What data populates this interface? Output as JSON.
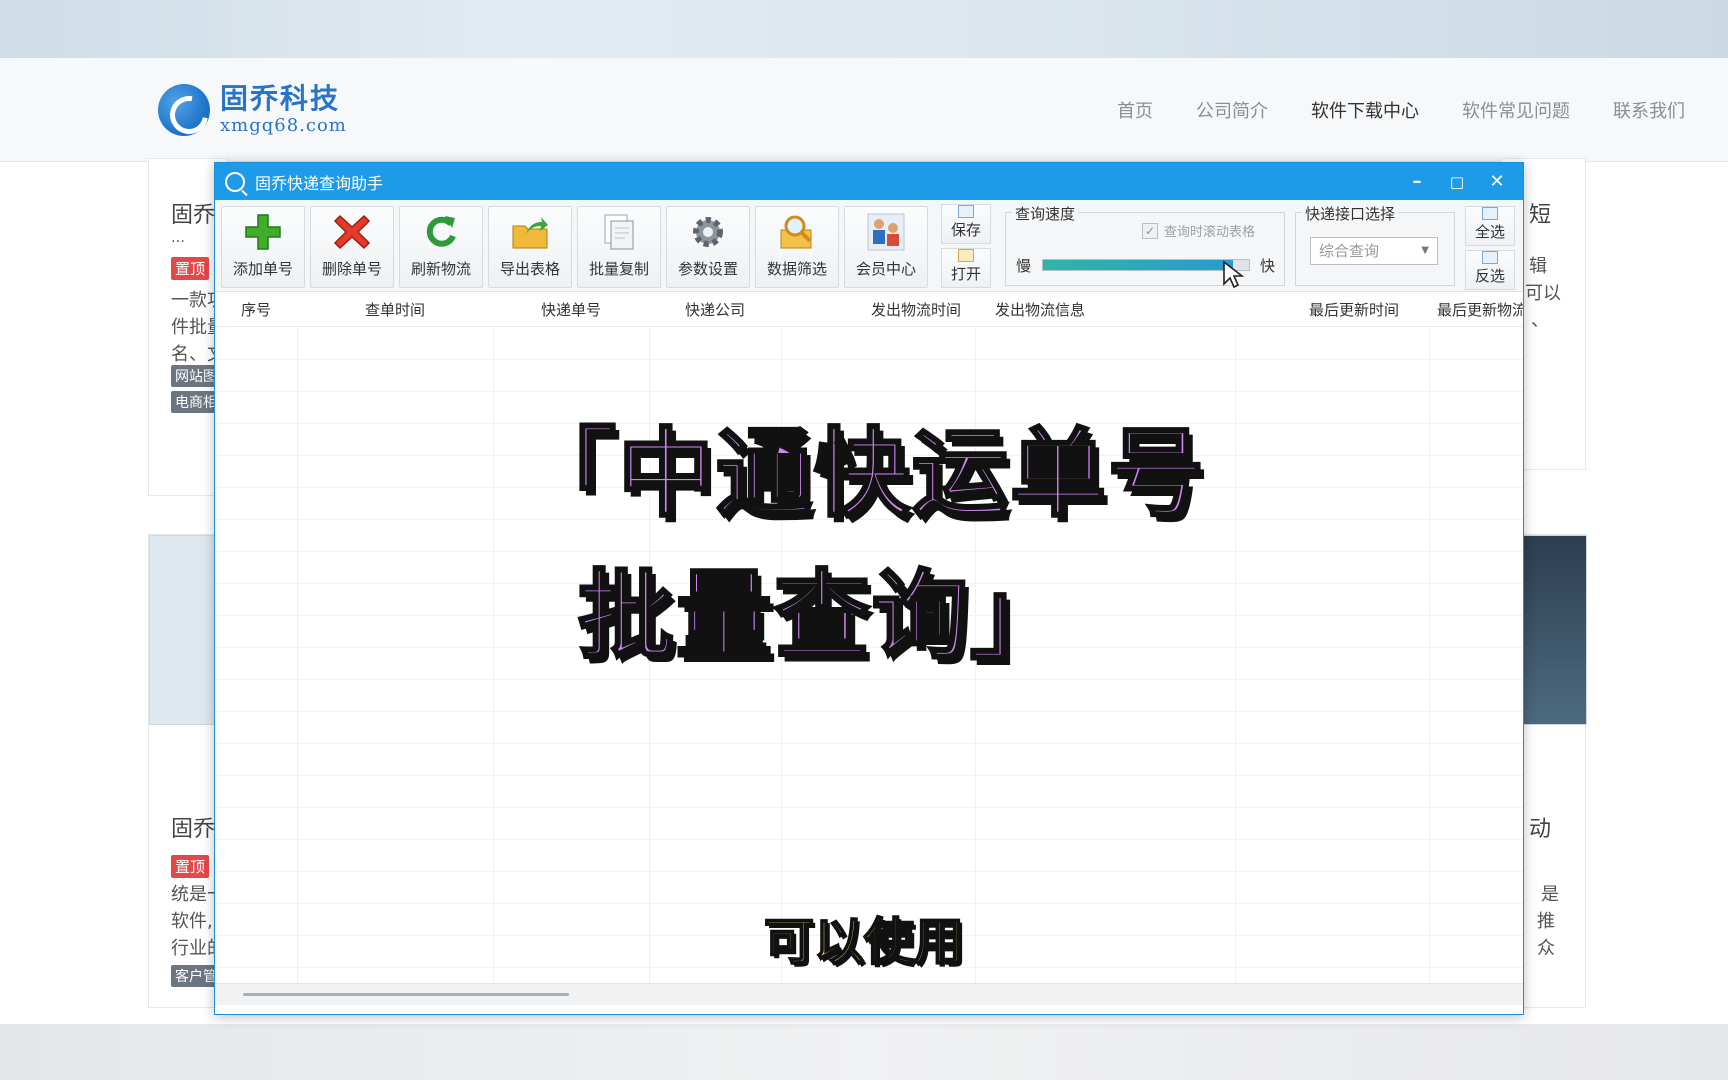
{
  "site": {
    "logo_cn": "固乔科技",
    "logo_url": "xmgq68.com",
    "nav": [
      "首页",
      "公司简介",
      "软件下载中心",
      "软件常见问题",
      "联系我们"
    ],
    "nav_active_index": 2,
    "cards": {
      "top_left_title": "固乔",
      "top_left_dots": "…",
      "top_left_tag": "置顶",
      "top_left_desc": [
        "一款功",
        "件批量",
        "名、文"
      ],
      "top_left_tags2": [
        "网站图",
        "电商相"
      ],
      "top_right_title": "短",
      "top_right_desc": [
        "辑",
        "可以",
        "、"
      ],
      "bottom_left_title": "固乔",
      "bottom_left_tag": "置顶",
      "bottom_left_desc": [
        "统是一",
        "软件,",
        "行业的"
      ],
      "bottom_left_tag2": "客户管",
      "bottom_right_title": "动",
      "bottom_right_desc": [
        "是",
        "推",
        "众"
      ]
    }
  },
  "app": {
    "title": "固乔快递查询助手",
    "controls": {
      "minimize": "–",
      "maximize": "□",
      "close": "✕"
    },
    "toolbar": [
      {
        "label": "添加单号",
        "icon": "add-icon"
      },
      {
        "label": "删除单号",
        "icon": "delete-icon"
      },
      {
        "label": "刷新物流",
        "icon": "refresh-icon"
      },
      {
        "label": "导出表格",
        "icon": "export-icon"
      },
      {
        "label": "批量复制",
        "icon": "copy-icon"
      },
      {
        "label": "参数设置",
        "icon": "gear-icon"
      },
      {
        "label": "数据筛选",
        "icon": "filter-icon"
      },
      {
        "label": "会员中心",
        "icon": "member-icon"
      }
    ],
    "save_label": "保存",
    "open_label": "打开",
    "speed": {
      "title": "查询速度",
      "scroll_checkbox_label": "查询时滚动表格",
      "scroll_checkbox_checked": true,
      "slow_label": "慢",
      "fast_label": "快",
      "level": 0.92
    },
    "interface": {
      "title": "快递接口选择",
      "selected": "综合查询"
    },
    "select_all_label": "全选",
    "invert_label": "反选",
    "columns": [
      "序号",
      "查单时间",
      "快递单号",
      "快递公司",
      "发出物流时间",
      "发出物流信息",
      "最后更新时间",
      "最后更新物流"
    ]
  },
  "overlay": {
    "title_line1": "「中通快运单号",
    "title_line2": "批量查询」",
    "subtitle": "可以使用"
  },
  "colors": {
    "titlebar": "#1d9ae8",
    "title_text": "#cf86f0",
    "subtitle_text": "#ffe35a",
    "brand": "#2a74c5"
  }
}
